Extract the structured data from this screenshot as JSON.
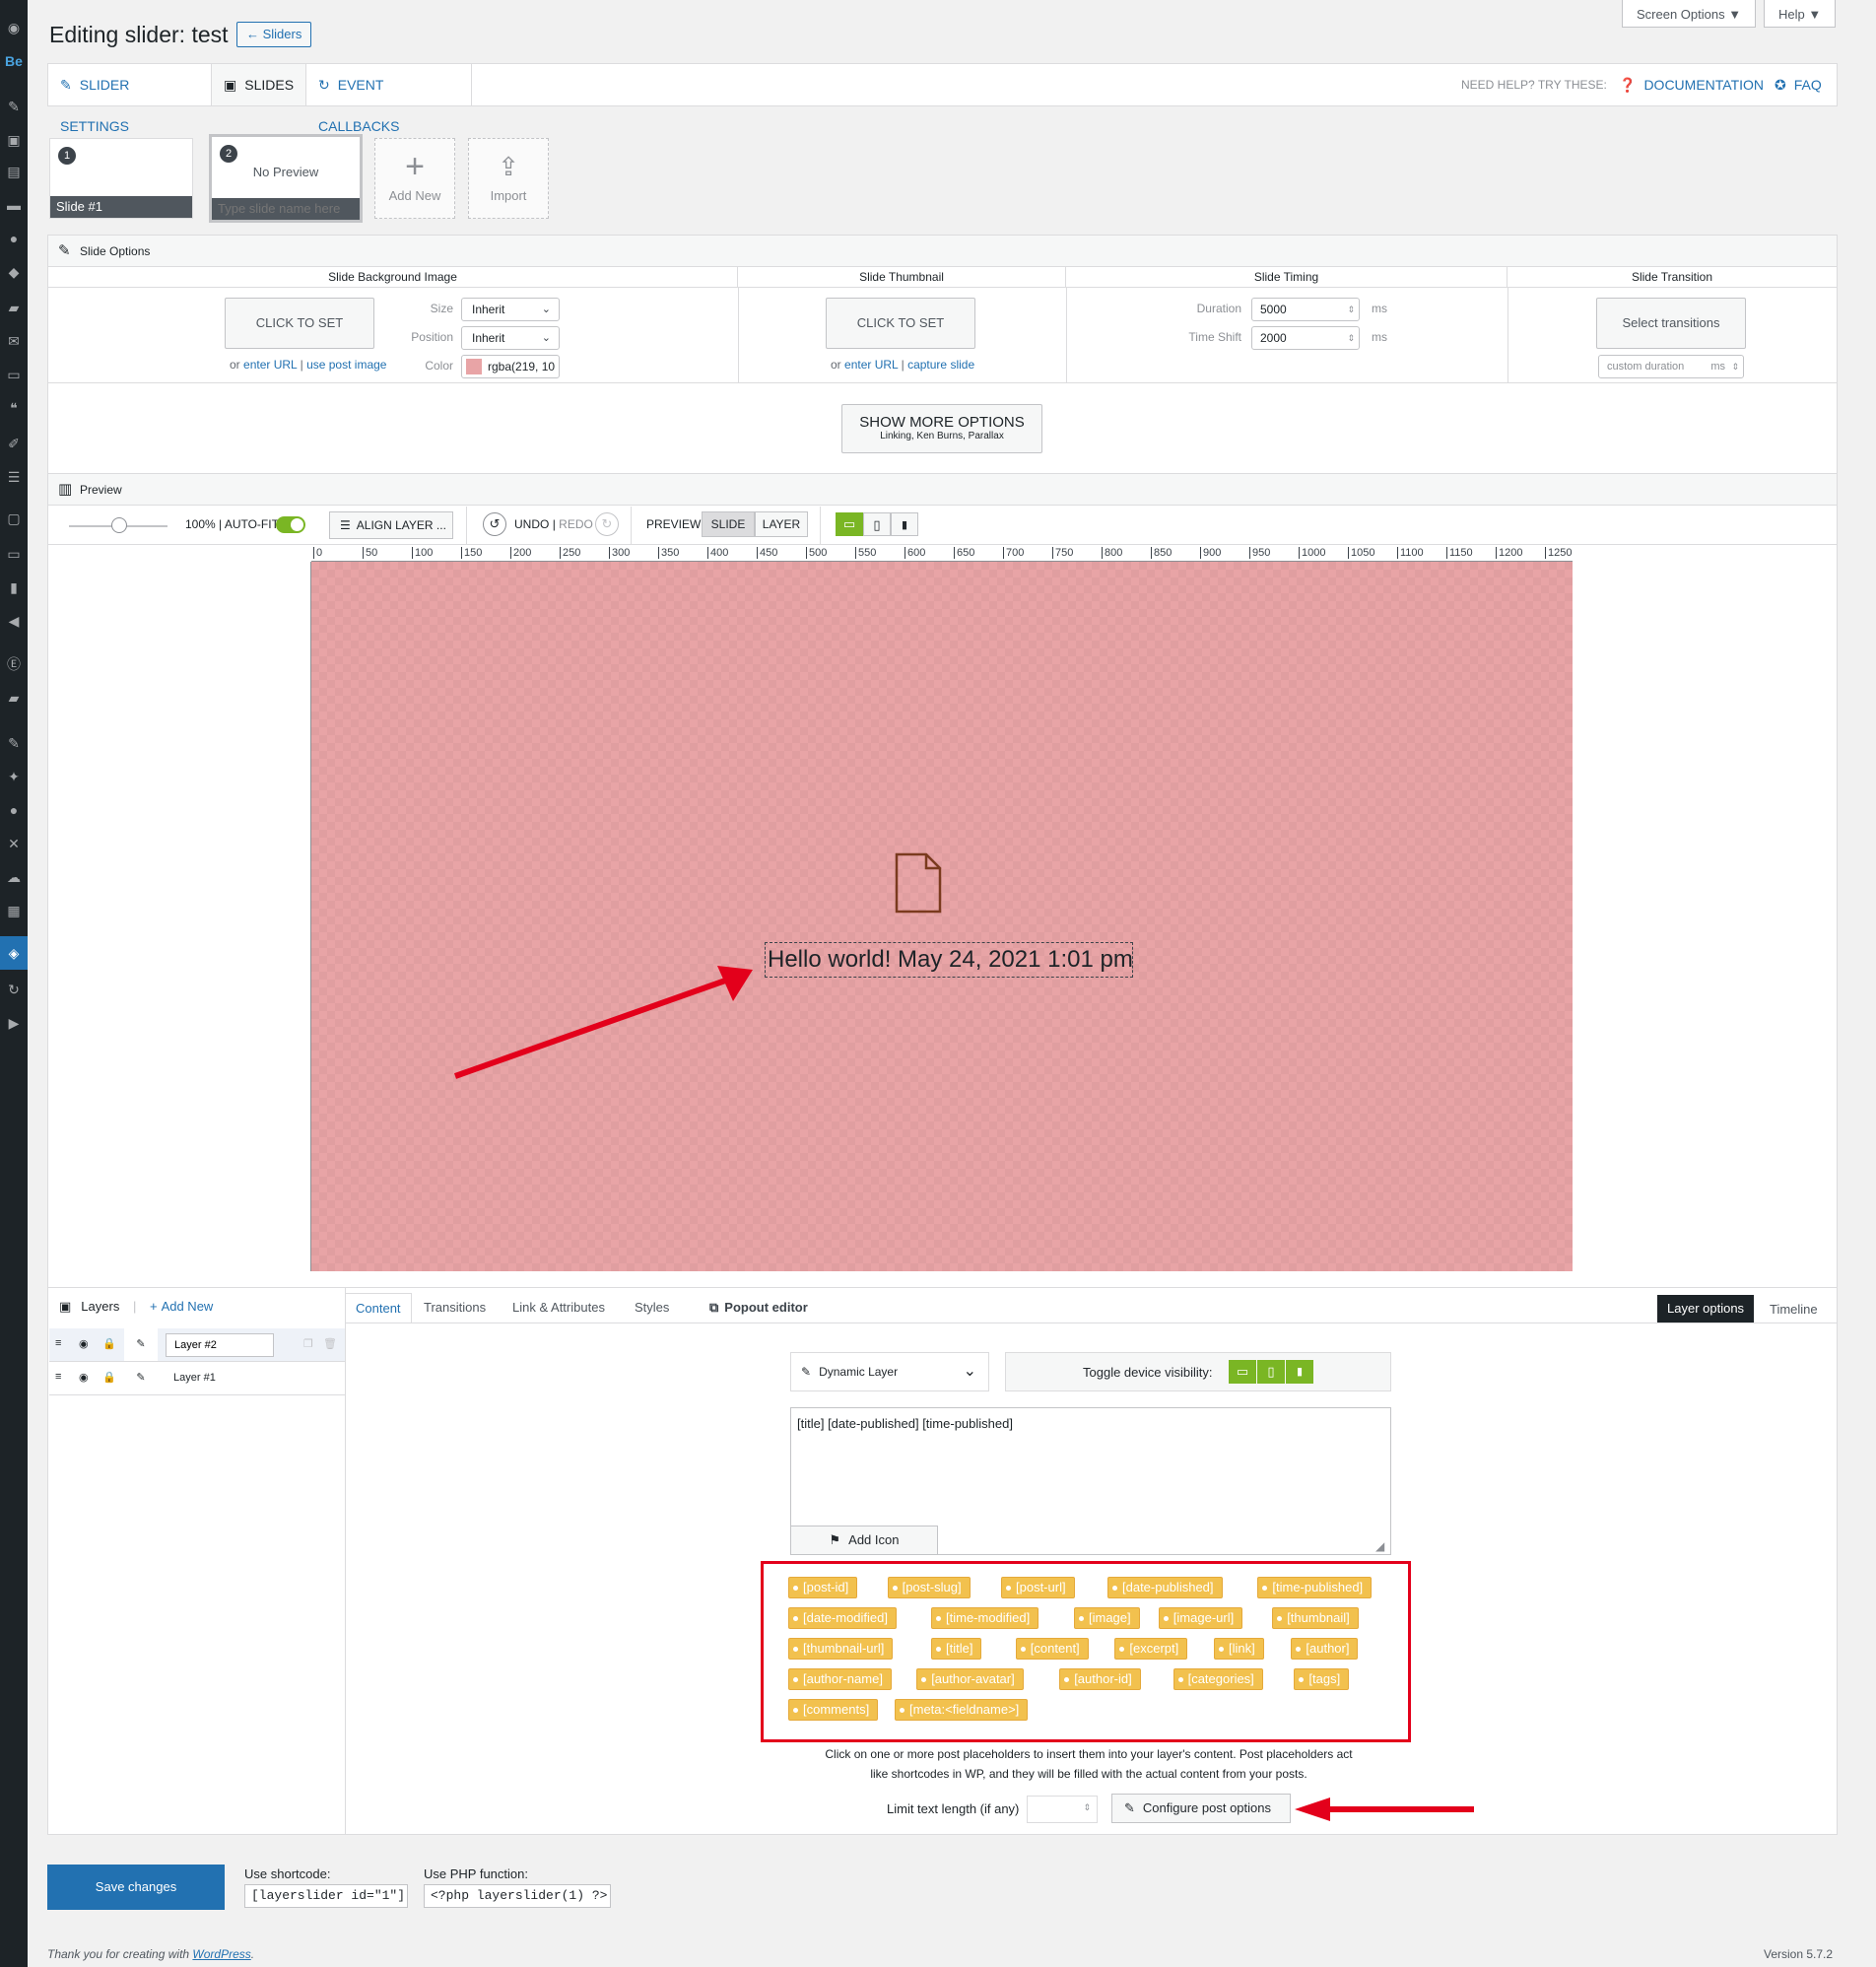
{
  "header": {
    "title": "Editing slider: test",
    "back_label": "← Sliders",
    "screen_options": "Screen Options ▼",
    "help": "Help ▼"
  },
  "tabs": {
    "slider_settings": "SLIDER SETTINGS",
    "slides": "SLIDES",
    "event_callbacks": "EVENT CALLBACKS",
    "need_help": "NEED HELP? TRY THESE:",
    "documentation": "DOCUMENTATION",
    "faq": "FAQ"
  },
  "slides": {
    "items": [
      {
        "num": "1",
        "name": "Slide #1",
        "preview": ""
      },
      {
        "num": "2",
        "name_placeholder": "Type slide name here",
        "preview": "No Preview"
      }
    ],
    "add_new": "Add New",
    "import": "Import"
  },
  "slide_options": {
    "title": "Slide Options",
    "bg": {
      "heading": "Slide Background Image",
      "click_to_set": "CLICK TO SET",
      "or": "or",
      "enter_url": "enter URL",
      "sep": "|",
      "use_post_image": "use post image",
      "size_label": "Size",
      "size_value": "Inherit",
      "position_label": "Position",
      "position_value": "Inherit",
      "color_label": "Color",
      "color_value": "rgba(219, 10"
    },
    "thumb": {
      "heading": "Slide Thumbnail",
      "click_to_set": "CLICK TO SET",
      "or": "or",
      "enter_url": "enter URL",
      "sep": "|",
      "capture_slide": "capture slide"
    },
    "timing": {
      "heading": "Slide Timing",
      "duration_label": "Duration",
      "duration_value": "5000",
      "timeshift_label": "Time Shift",
      "timeshift_value": "2000",
      "unit": "ms"
    },
    "transition": {
      "heading": "Slide Transition",
      "select": "Select transitions",
      "custom_placeholder": "custom duration",
      "unit": "ms"
    },
    "show_more": "SHOW MORE OPTIONS",
    "show_more_sub": "Linking, Ken Burns, Parallax"
  },
  "preview": {
    "title": "Preview",
    "zoom": "100% | AUTO-FIT",
    "align_layer": "ALIGN LAYER ...",
    "undo": "UNDO",
    "pipe": "|",
    "redo": "REDO",
    "preview_label": "PREVIEW",
    "slide_btn": "SLIDE",
    "layer_btn": "LAYER",
    "ruler": [
      "0",
      "50",
      "100",
      "150",
      "200",
      "250",
      "300",
      "350",
      "400",
      "450",
      "500",
      "550",
      "600",
      "650",
      "700",
      "750",
      "800",
      "850",
      "900",
      "950",
      "1000",
      "1050",
      "1100",
      "1150",
      "1200",
      "1250"
    ],
    "layer_text": "Hello world! May 24, 2021 1:01 pm",
    "canvas_color": "#e8a4a6"
  },
  "layers": {
    "title": "Layers",
    "pipe": "|",
    "add_new": "Add New",
    "items": [
      {
        "name": "Layer #2"
      },
      {
        "name": "Layer #1"
      }
    ]
  },
  "editor": {
    "tabs": {
      "content": "Content",
      "transitions": "Transitions",
      "link": "Link & Attributes",
      "styles": "Styles",
      "popout": "Popout editor",
      "layer_options": "Layer options",
      "timeline": "Timeline"
    },
    "layer_type": "Dynamic Layer",
    "toggle_visibility": "Toggle device visibility:",
    "content_text": "[title] [date-published] [time-published]",
    "add_icon": "Add Icon",
    "placeholders": [
      "[post-id]",
      "[post-slug]",
      "[post-url]",
      "[date-published]",
      "[time-published]",
      "[date-modified]",
      "[time-modified]",
      "[image]",
      "[image-url]",
      "[thumbnail]",
      "[thumbnail-url]",
      "[title]",
      "[content]",
      "[excerpt]",
      "[link]",
      "[author]",
      "[author-name]",
      "[author-avatar]",
      "[author-id]",
      "[categories]",
      "[tags]",
      "[comments]",
      "[meta:<fieldname>]"
    ],
    "help_line1": "Click on one or more post placeholders to insert them into your layer's content. Post placeholders act",
    "help_line2": "like shortcodes in WP, and they will be filled with the actual content from your posts.",
    "limit_label": "Limit text length (if any)",
    "configure": "Configure post options"
  },
  "footer": {
    "save": "Save changes",
    "shortcode_label": "Use shortcode:",
    "shortcode": "[layerslider id=\"1\"]",
    "php_label": "Use PHP function:",
    "php": "<?php layerslider(1) ?>",
    "thanks_prefix": "Thank you for creating with ",
    "wordpress": "WordPress",
    "thanks_suffix": ".",
    "version": "Version 5.7.2"
  },
  "colors": {
    "accent": "#2271b1",
    "save_bg": "#2271b1",
    "tag_bg": "#f2c14e",
    "highlight": "#e3001b",
    "device_green": "#7ab624"
  }
}
